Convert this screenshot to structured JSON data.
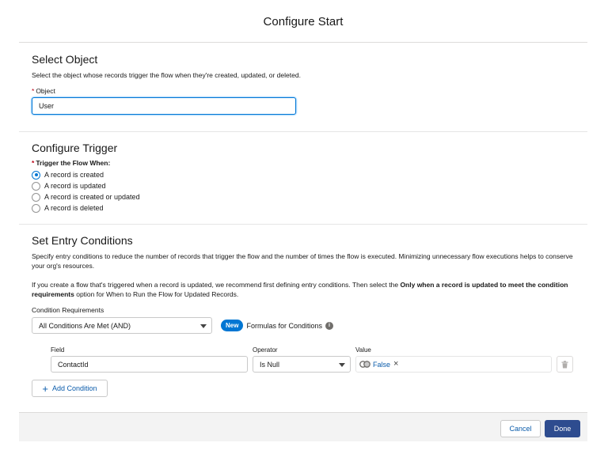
{
  "modal": {
    "title": "Configure Start"
  },
  "select_object": {
    "heading": "Select Object",
    "description": "Select the object whose records trigger the flow when they're created, updated, or deleted.",
    "required_marker": "*",
    "object_label": "Object",
    "object_value": "User"
  },
  "configure_trigger": {
    "heading": "Configure Trigger",
    "required_marker": "*",
    "trigger_label": "Trigger the Flow When:",
    "options": [
      {
        "label": "A record is created",
        "selected": true
      },
      {
        "label": "A record is updated",
        "selected": false
      },
      {
        "label": "A record is created or updated",
        "selected": false
      },
      {
        "label": "A record is deleted",
        "selected": false
      }
    ]
  },
  "entry_conditions": {
    "heading": "Set Entry Conditions",
    "description": "Specify entry conditions to reduce the number of records that trigger the flow and the number of times the flow is executed. Minimizing unnecessary flow executions helps to conserve your org's resources.",
    "recommend_pre": "If you create a flow that's triggered when a record is updated, we recommend first defining entry conditions. Then select the ",
    "recommend_bold": "Only when a record is updated to meet the condition requirements",
    "recommend_post": " option for When to Run the Flow for Updated Records.",
    "condition_requirements_label": "Condition Requirements",
    "condition_requirements_value": "All Conditions Are Met (AND)",
    "new_badge": "New",
    "formulas_label": "Formulas for Conditions",
    "info_icon": "i",
    "field_header": "Field",
    "operator_header": "Operator",
    "value_header": "Value",
    "condition": {
      "field": "ContactId",
      "operator": "Is Null",
      "value": "False",
      "remove_glyph": "×"
    },
    "add_condition_plus": "+",
    "add_condition_label": "Add Condition"
  },
  "footer": {
    "cancel_label": "Cancel",
    "done_label": "Done"
  },
  "colors": {
    "brand": "#0176d3",
    "done_button": "#2e4c8f",
    "link": "#0b5cab",
    "required": "#ba0517"
  }
}
